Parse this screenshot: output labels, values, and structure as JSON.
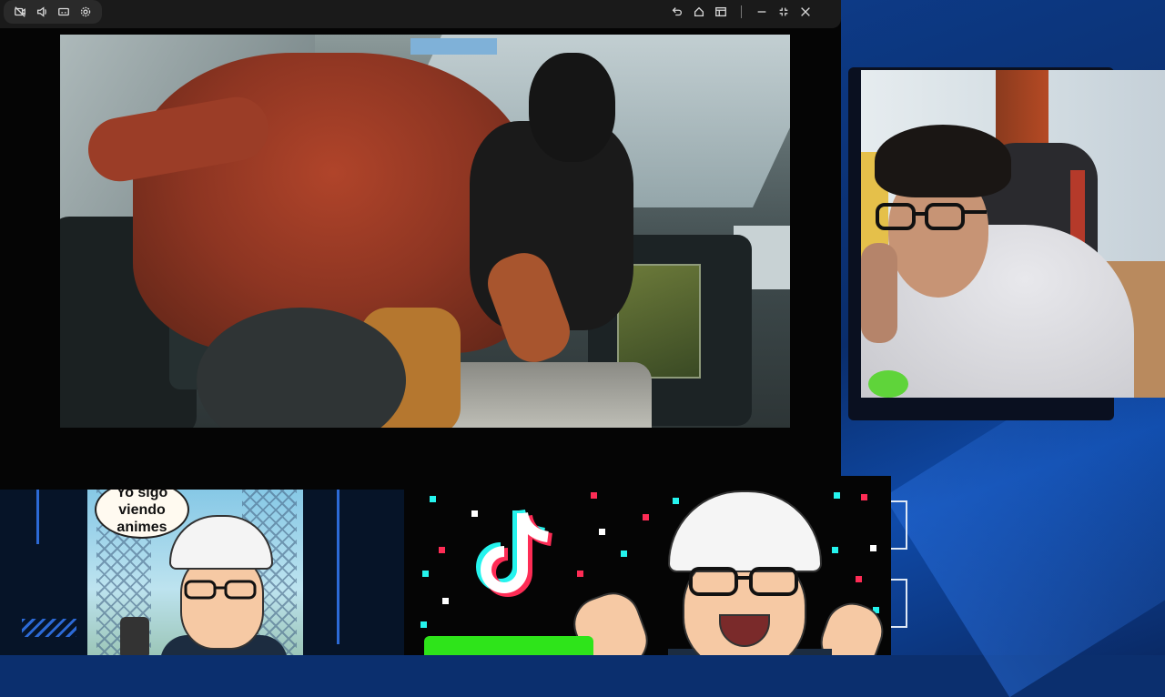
{
  "titlebar": {
    "left_icons": [
      "video-off-icon",
      "volume-icon",
      "captions-icon",
      "settings-icon"
    ],
    "right_icons": [
      "undo-icon",
      "home-icon",
      "layout-icon",
      "minimize-icon",
      "fullscreen-icon",
      "close-icon"
    ]
  },
  "poster": {
    "bubble_line1": "Yo sigo",
    "bubble_line2": "viendo",
    "bubble_line3": "animes"
  },
  "colors": {
    "accent_blue": "#2c6ad6",
    "tiktok_cyan": "#25f4ee",
    "tiktok_red": "#fe2c55",
    "green_bar": "#2ee41a"
  }
}
